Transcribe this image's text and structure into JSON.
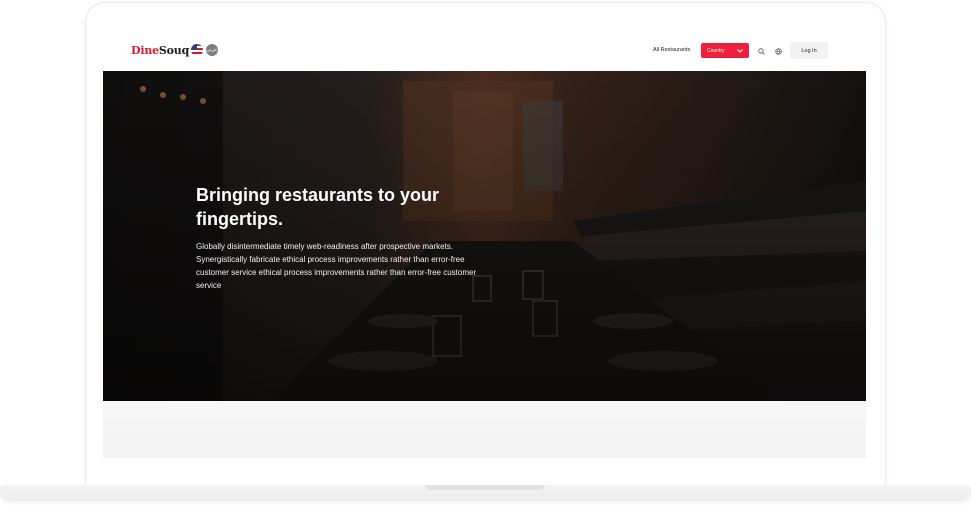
{
  "brand": {
    "name_part1": "Dine",
    "name_part2": "Souq"
  },
  "language": {
    "flags": [
      "us-flag-icon",
      "arabic-language-icon"
    ],
    "arabic_label": "عربي"
  },
  "nav": {
    "all_restaurants": "All Restaurants",
    "country_label": "Country",
    "login_label": "Log In",
    "icons": [
      "search-icon",
      "globe-icon",
      "chevron-down-icon"
    ]
  },
  "hero": {
    "title": "Bringing restaurants to your fingertips.",
    "description": "Globally disintermediate timely web-readiness after prospective markets. Synergistically fabricate ethical process improvements rather than error-free customer service  ethical process improvements rather than error-free customer service"
  },
  "colors": {
    "accent": "#ee1f3c",
    "brand_red": "#d8182c",
    "dark": "#1c1c1c"
  }
}
